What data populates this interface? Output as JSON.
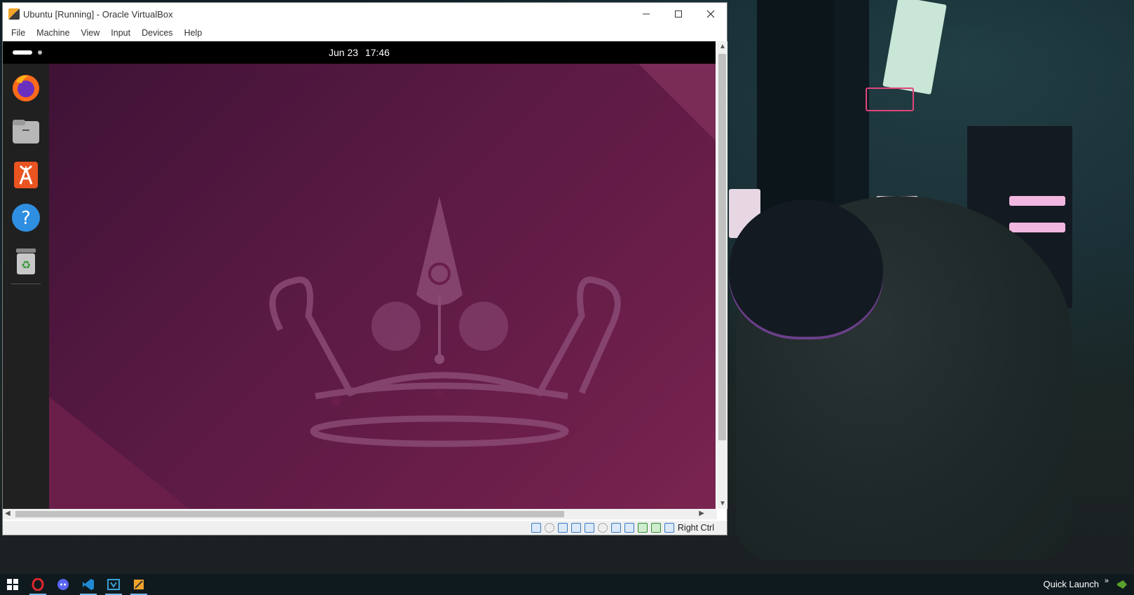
{
  "window": {
    "title": "Ubuntu [Running] - Oracle VirtualBox",
    "minimize_icon": "minimize-icon",
    "maximize_icon": "maximize-icon",
    "close_icon": "close-icon"
  },
  "menu": {
    "items": [
      "File",
      "Machine",
      "View",
      "Input",
      "Devices",
      "Help"
    ]
  },
  "guest": {
    "topbar": {
      "date": "Jun 23",
      "time": "17:46"
    },
    "dock": {
      "apps": [
        {
          "name": "Firefox",
          "icon": "firefox-icon"
        },
        {
          "name": "Files",
          "icon": "files-icon"
        },
        {
          "name": "Ubuntu Software",
          "icon": "software-store-icon"
        },
        {
          "name": "Help",
          "icon": "help-icon"
        },
        {
          "name": "Trash",
          "icon": "trash-icon"
        }
      ]
    },
    "wallpaper_colors": {
      "dark": "#3f1236",
      "mid": "#5a1a44",
      "light": "#7a2550",
      "crown": "#8a4a74"
    }
  },
  "statusbar": {
    "host_key": "Right Ctrl",
    "icons": [
      "hard-disk-icon",
      "optical-drive-icon",
      "audio-icon",
      "network-icon",
      "usb-icon",
      "shared-folders-icon",
      "display-icon",
      "recording-icon",
      "mouse-integration-icon",
      "cpu-icon",
      "keyboard-icon"
    ]
  },
  "taskbar": {
    "items": [
      {
        "icon": "windows-start-icon",
        "active": false
      },
      {
        "icon": "opera-icon",
        "active": true
      },
      {
        "icon": "discord-icon",
        "active": false
      },
      {
        "icon": "vscode-icon",
        "active": true
      },
      {
        "icon": "visual-studio-icon",
        "active": true
      },
      {
        "icon": "virtualbox-icon",
        "active": true
      }
    ],
    "quick_launch": "Quick Launch",
    "chevron": "»"
  }
}
